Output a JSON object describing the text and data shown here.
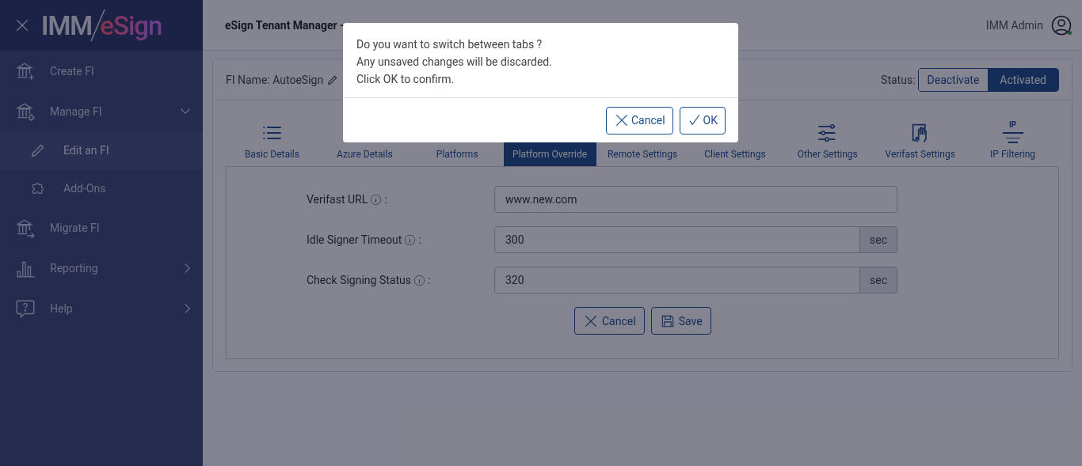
{
  "sidebar": {
    "logo": {
      "left": "IMM",
      "right": "eSign"
    },
    "items": [
      {
        "label": "Create FI",
        "kind": "create",
        "selected": false
      },
      {
        "label": "Manage FI",
        "kind": "manage",
        "expanded": true,
        "selected": false,
        "children": [
          {
            "label": "Edit an FI",
            "kind": "edit",
            "selected": true
          },
          {
            "label": "Add-Ons",
            "kind": "addons",
            "selected": false
          }
        ]
      },
      {
        "label": "Migrate FI",
        "kind": "migrate",
        "selected": false
      },
      {
        "label": "Reporting",
        "kind": "report",
        "expanded": false,
        "selected": false
      },
      {
        "label": "Help",
        "kind": "help",
        "expanded": false,
        "selected": false
      }
    ]
  },
  "header": {
    "title": "eSign Tenant Manager -",
    "user": "IMM Admin",
    "online": true
  },
  "card": {
    "fi_name": "FI Name: AutoeSign",
    "status_label": "Status:",
    "status_options": [
      {
        "label": "Deactivate",
        "selected": false
      },
      {
        "label": "Activated",
        "selected": true
      }
    ],
    "tabs": [
      {
        "label": "Basic Details",
        "kind": "basic",
        "selected": false
      },
      {
        "label": "Azure Details",
        "selected": false
      },
      {
        "label": "Platforms",
        "selected": false
      },
      {
        "label": "Platform Override",
        "selected": true
      },
      {
        "label": "Remote Settings",
        "selected": false
      },
      {
        "label": "Client Settings",
        "selected": false
      },
      {
        "label": "Other Settings",
        "kind": "other",
        "selected": false
      },
      {
        "label": "Verifast Settings",
        "kind": "verifast",
        "selected": false
      },
      {
        "label": "IP Filtering",
        "kind": "filter",
        "icon_text": "IP",
        "selected": false
      }
    ],
    "fields": [
      {
        "label": "Verifast URL",
        "value": "www.new.com"
      },
      {
        "label": "Idle Signer Timeout",
        "value": "300",
        "unit": "sec"
      },
      {
        "label": "Check Signing Status",
        "value": "320",
        "unit": "sec"
      }
    ],
    "colon": ":",
    "buttons": [
      {
        "label": "Cancel",
        "kind": "cancel"
      },
      {
        "label": "Save",
        "kind": "save"
      }
    ]
  },
  "dialog": {
    "lines": [
      "Do you want to switch between tabs ?",
      "Any unsaved changes will be discarded.",
      "Click OK to confirm."
    ],
    "buttons": [
      {
        "label": "Cancel",
        "kind": "cancel"
      },
      {
        "label": "OK",
        "kind": "ok"
      }
    ]
  }
}
